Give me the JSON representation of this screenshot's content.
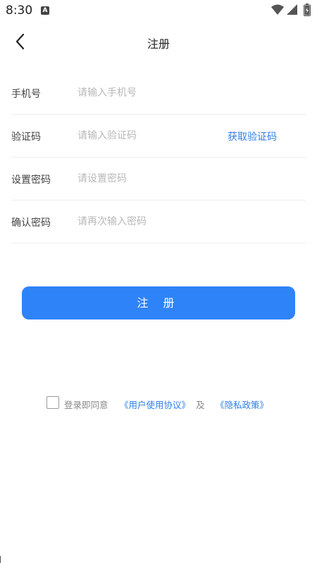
{
  "status_bar": {
    "time": "8:30",
    "notification_icon": "A",
    "icons": [
      "wifi-icon",
      "signal-icon",
      "battery-icon"
    ]
  },
  "nav": {
    "back_icon": "chevron-left-icon",
    "title": "注册"
  },
  "form": {
    "phone": {
      "label": "手机号",
      "placeholder": "请输入手机号",
      "value": ""
    },
    "code": {
      "label": "验证码",
      "placeholder": "请输入验证码",
      "value": "",
      "action": "获取验证码"
    },
    "password": {
      "label": "设置密码",
      "placeholder": "请设置密码",
      "value": ""
    },
    "confirm": {
      "label": "确认密码",
      "placeholder": "请再次输入密码",
      "value": ""
    }
  },
  "register_button": "注 册",
  "agreement": {
    "checked": false,
    "prefix": "登录即同意",
    "user_agreement": "《用户使用协议》",
    "and": "及",
    "privacy_policy": "《隐私政策》"
  },
  "colors": {
    "accent": "#2f83f8",
    "link": "#2d7fe7",
    "placeholder": "#b8b8b8",
    "divider": "#eeeeee"
  }
}
